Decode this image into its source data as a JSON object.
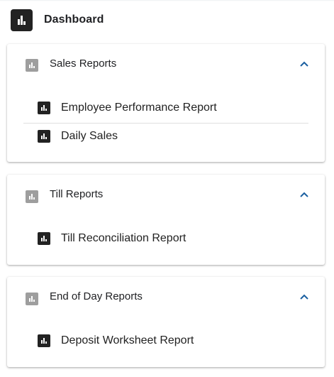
{
  "header": {
    "title": "Dashboard",
    "icon": "bar-chart-icon"
  },
  "sections": [
    {
      "title": "Sales Reports",
      "icon": "bar-chart-icon",
      "expanded": true,
      "items": [
        {
          "label": "Employee Performance Report",
          "icon": "bar-chart-icon"
        },
        {
          "label": "Daily Sales",
          "icon": "bar-chart-icon"
        }
      ]
    },
    {
      "title": "Till Reports",
      "icon": "bar-chart-icon",
      "expanded": true,
      "items": [
        {
          "label": "Till Reconciliation Report",
          "icon": "bar-chart-icon"
        }
      ]
    },
    {
      "title": "End of Day Reports",
      "icon": "bar-chart-icon",
      "expanded": true,
      "items": [
        {
          "label": "Deposit Worksheet Report",
          "icon": "bar-chart-icon"
        }
      ]
    }
  ],
  "colors": {
    "accent": "#1a5fa0",
    "section_icon": "#9e9e9e",
    "item_icon": "#222222"
  }
}
